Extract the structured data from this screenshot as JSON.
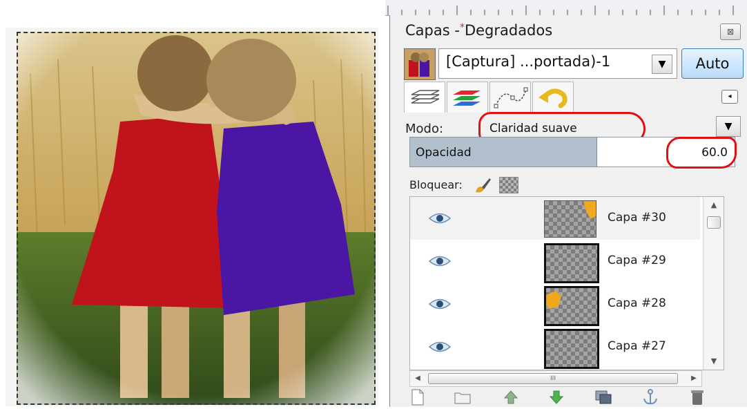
{
  "panel": {
    "title": "Capas -",
    "title_mark": "*",
    "title_doc": "Degradados",
    "close_label": "⊠"
  },
  "image_selector": {
    "name": "[Captura] ...portada)-1",
    "dropdown_glyph": "▼",
    "auto_label": "Auto"
  },
  "tabs": [
    {
      "name": "layers",
      "icon": "layers-stack-icon"
    },
    {
      "name": "channels",
      "icon": "channels-icon"
    },
    {
      "name": "paths",
      "icon": "paths-icon"
    },
    {
      "name": "undo",
      "icon": "undo-history-icon"
    }
  ],
  "tab_menu_glyph": "◂",
  "mode": {
    "label": "Modo:",
    "value": "Claridad suave",
    "dropdown_glyph": "▼"
  },
  "opacity": {
    "label": "Opacidad",
    "value": "60.0",
    "fraction": 0.6
  },
  "lock": {
    "label": "Bloquear:"
  },
  "layers": [
    {
      "name": "Capa #30",
      "visible": true,
      "selected": true,
      "thumb": "corner-shape"
    },
    {
      "name": "Capa #29",
      "visible": true,
      "selected": false,
      "thumb": "empty"
    },
    {
      "name": "Capa #28",
      "visible": true,
      "selected": false,
      "thumb": "left-shape"
    },
    {
      "name": "Capa #27",
      "visible": true,
      "selected": false,
      "thumb": "empty"
    }
  ],
  "scroll": {
    "up": "▲",
    "down": "▼",
    "left": "◀",
    "right": "▶",
    "grip": "III"
  },
  "toolbar": [
    "new-layer-icon",
    "new-layer-group-icon",
    "raise-layer-icon",
    "lower-layer-icon",
    "duplicate-layer-icon",
    "anchor-layer-icon",
    "delete-layer-icon"
  ],
  "colors": {
    "annotation_red": "#e01010",
    "auto_button_blue": "#3b7bbd",
    "opacity_fill": "#b2c0ce",
    "dress_red": "#c0131b",
    "dress_purple": "#4a16a3"
  }
}
